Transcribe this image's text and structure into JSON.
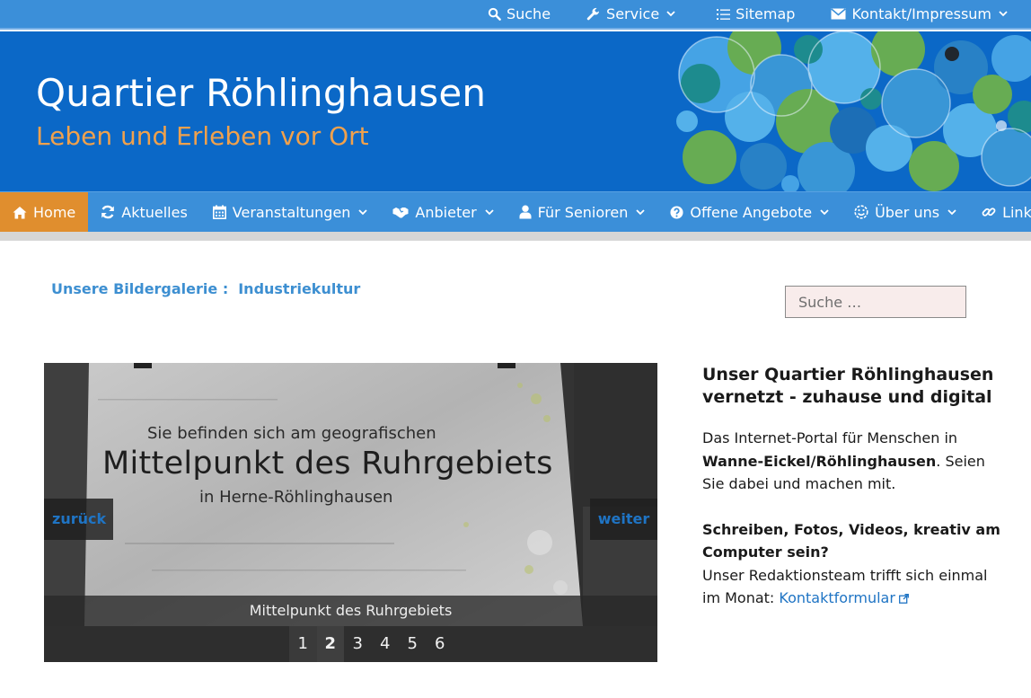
{
  "topbar": {
    "search_label": "Suche",
    "service_label": "Service",
    "sitemap_label": "Sitemap",
    "contact_label": "Kontakt/Impressum"
  },
  "header": {
    "title": "Quartier Röhlinghausen",
    "tagline": "Leben und Erleben vor Ort"
  },
  "nav": {
    "items": [
      {
        "label": "Home",
        "icon": "home-icon",
        "active": true
      },
      {
        "label": "Aktuelles",
        "icon": "refresh-icon"
      },
      {
        "label": "Veranstaltungen",
        "icon": "calendar-icon"
      },
      {
        "label": "Anbieter",
        "icon": "handshake-icon"
      },
      {
        "label": "Für Senioren",
        "icon": "user-icon"
      },
      {
        "label": "Offene Angebote",
        "icon": "question-circle-icon"
      },
      {
        "label": "Über uns",
        "icon": "smile-icon"
      },
      {
        "label": "Links",
        "icon": "link-icon"
      }
    ]
  },
  "gallery": {
    "prefix": "Unsere Bildergalerie :",
    "name": "Industriekultur",
    "plate_line1": "Sie befinden sich am geografischen",
    "plate_line2": "Mittelpunkt des Ruhrgebiets",
    "plate_line3": "in Herne-Röhlinghausen",
    "caption": "Mittelpunkt des Ruhrgebiets",
    "prev_label": "zurück",
    "next_label": "weiter",
    "pages": [
      "1",
      "2",
      "3",
      "4",
      "5",
      "6"
    ],
    "current_page": "2"
  },
  "sidebar": {
    "search_placeholder": "Suche …",
    "title": "Unser Quartier Röhlinghausen vernetzt - zuhause und digital",
    "intro_before": "Das Internet-Portal für Menschen in ",
    "intro_bold": "Wanne-Eickel/Röhlinghausen",
    "intro_after": ". Seien Sie dabei und machen mit.",
    "cta_bold": "Schreiben, Fotos, Videos, kreativ am Computer sein?",
    "cta_text": "Unser Redaktionsteam trifft sich einmal im Monat: ",
    "cta_link": "Kontaktformular"
  },
  "colors": {
    "bar_blue": "#3b8fd9",
    "header_blue": "#0b68c7",
    "active_orange": "#e08e2e",
    "tagline_orange": "#f0a14c",
    "link_blue": "#1f74c4"
  }
}
